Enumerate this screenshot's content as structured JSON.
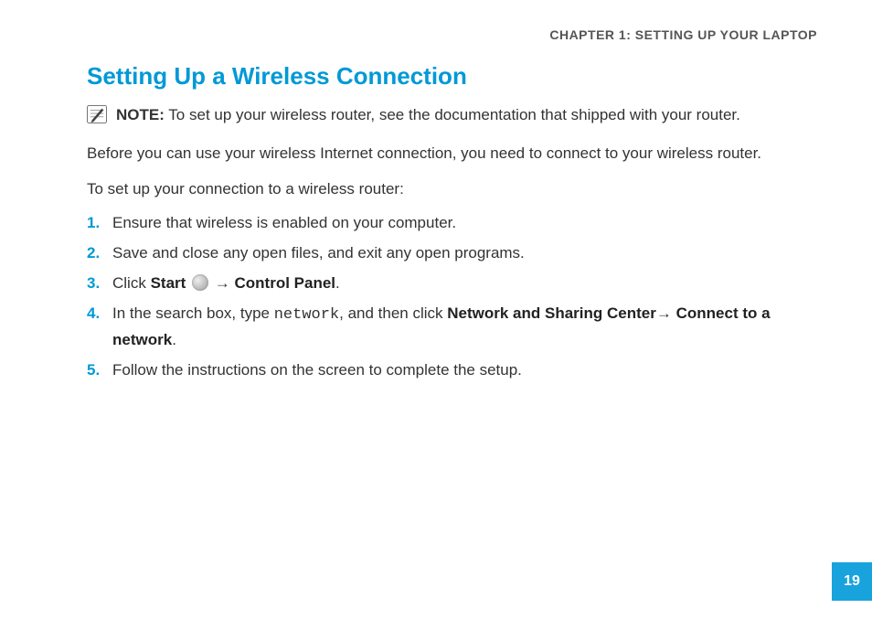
{
  "chapter_header": "CHAPTER 1:  SETTING UP YOUR LAPTOP",
  "section_title": "Setting Up a Wireless Connection",
  "note": {
    "label": "NOTE:",
    "text": " To set up your wireless router, see the documentation that shipped with your router."
  },
  "intro_paragraph": "Before you can use your wireless Internet connection, you need to connect to your wireless router.",
  "intro_paragraph2": "To set up your connection to a wireless router:",
  "steps": {
    "s1": "Ensure that wireless is enabled on your computer.",
    "s2": "Save and close any open files, and exit any open programs.",
    "s3_prefix": "Click ",
    "s3_start": "Start ",
    "s3_arrow": "→ ",
    "s3_cp": "Control Panel",
    "s3_suffix": ".",
    "s4_prefix": "In the search box, type ",
    "s4_code": "network",
    "s4_mid": ", and then click ",
    "s4_nsc": "Network and Sharing Center",
    "s4_arrow": "→ ",
    "s4_connect": "Connect to a network",
    "s4_suffix": ".",
    "s5": "Follow the instructions on the screen to complete the setup."
  },
  "page_number": "19"
}
